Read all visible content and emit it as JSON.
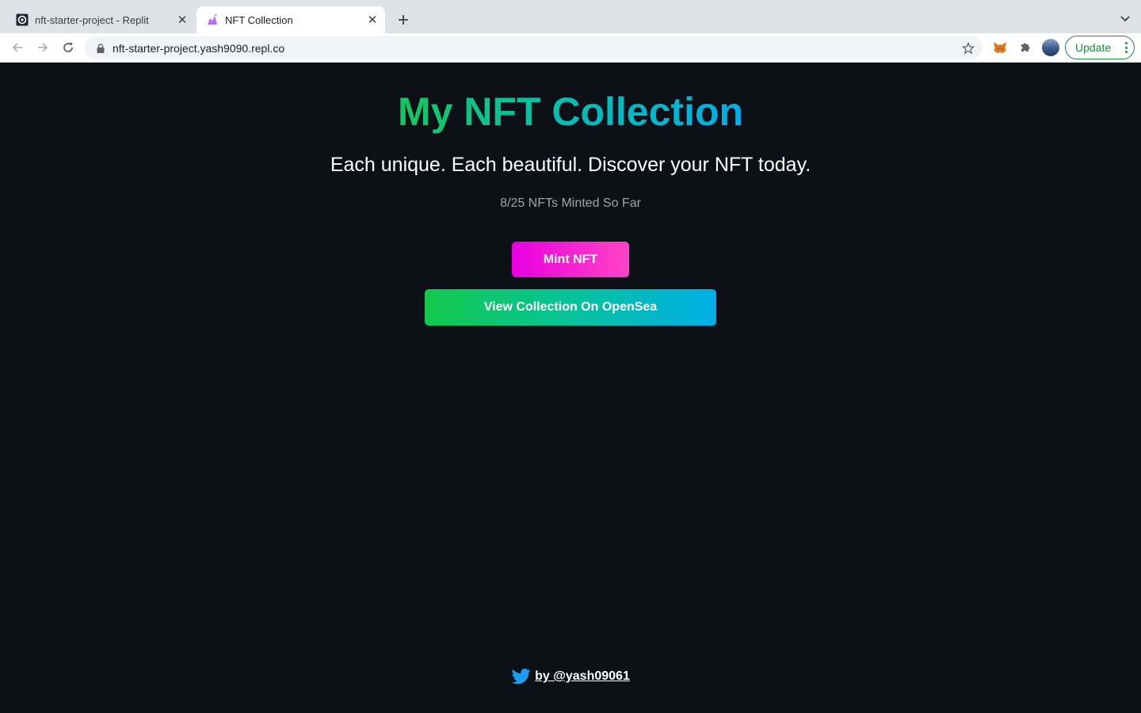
{
  "browser": {
    "tabs": [
      {
        "title": "nft-starter-project - Replit",
        "favicon": "replit-icon",
        "active": false
      },
      {
        "title": "NFT Collection",
        "favicon": "unicorn-icon",
        "active": true
      }
    ],
    "url": "nft-starter-project.yash9090.repl.co",
    "update_label": "Update",
    "icons": {
      "back": "back-arrow-icon",
      "forward": "forward-arrow-icon",
      "reload": "reload-icon",
      "lock": "lock-icon",
      "bookmark": "star-icon",
      "metamask": "metamask-fox-icon",
      "extensions": "puzzle-icon",
      "new_tab": "plus-icon",
      "tab_search": "chevron-down-icon"
    }
  },
  "page": {
    "title": "My NFT Collection",
    "subtitle": "Each unique. Each beautiful. Discover your NFT today.",
    "minted_status": "8/25 NFTs Minted So Far",
    "mint_button": "Mint NFT",
    "opensea_button": "View Collection On OpenSea",
    "footer_handle": "by @yash09061",
    "footer_icon": "twitter-icon"
  },
  "colors": {
    "background": "#0d1117",
    "title_gradient": [
      "#13c65e",
      "#00aee8"
    ],
    "mint_gradient": [
      "#e800e0",
      "#ff44c6"
    ],
    "opensea_gradient": [
      "#14c84c",
      "#00aee8"
    ],
    "muted_text": "#a0a4ab",
    "update_green": "#1e8e3e"
  }
}
